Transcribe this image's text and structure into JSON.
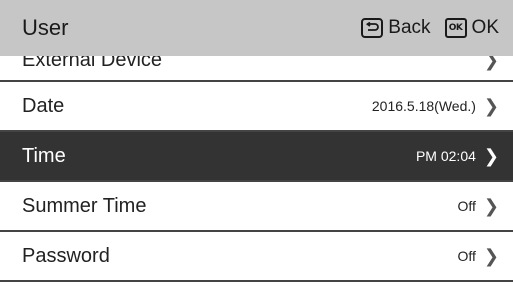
{
  "header": {
    "title": "User",
    "back_label": "Back",
    "ok_icon_text": "OK",
    "ok_label": "OK"
  },
  "menu": {
    "items": [
      {
        "label": "External Device",
        "value": "",
        "selected": false,
        "partial": true
      },
      {
        "label": "Date",
        "value": "2016.5.18(Wed.)",
        "selected": false
      },
      {
        "label": "Time",
        "value": "PM 02:04",
        "selected": true
      },
      {
        "label": "Summer Time",
        "value": "Off",
        "selected": false
      },
      {
        "label": "Password",
        "value": "Off",
        "selected": false
      }
    ]
  },
  "colors": {
    "header_bg": "#c6c6c6",
    "selected_bg": "#333333",
    "divider": "#444444"
  }
}
